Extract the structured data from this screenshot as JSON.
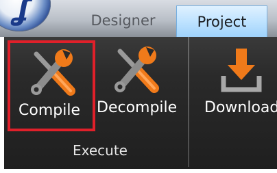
{
  "tabs": {
    "designer": "Designer",
    "project": "Project"
  },
  "ribbon": {
    "buttons": {
      "compile": "Compile",
      "decompile": "Decompile",
      "download": "Download"
    },
    "group_label": "Execute"
  },
  "colors": {
    "highlight_border": "#e0202a",
    "icon_orange": "#f07a1a",
    "active_tab": "#bfe3ff"
  },
  "icons": [
    "app-logo",
    "wrench-screwdriver-icon",
    "download-icon"
  ]
}
